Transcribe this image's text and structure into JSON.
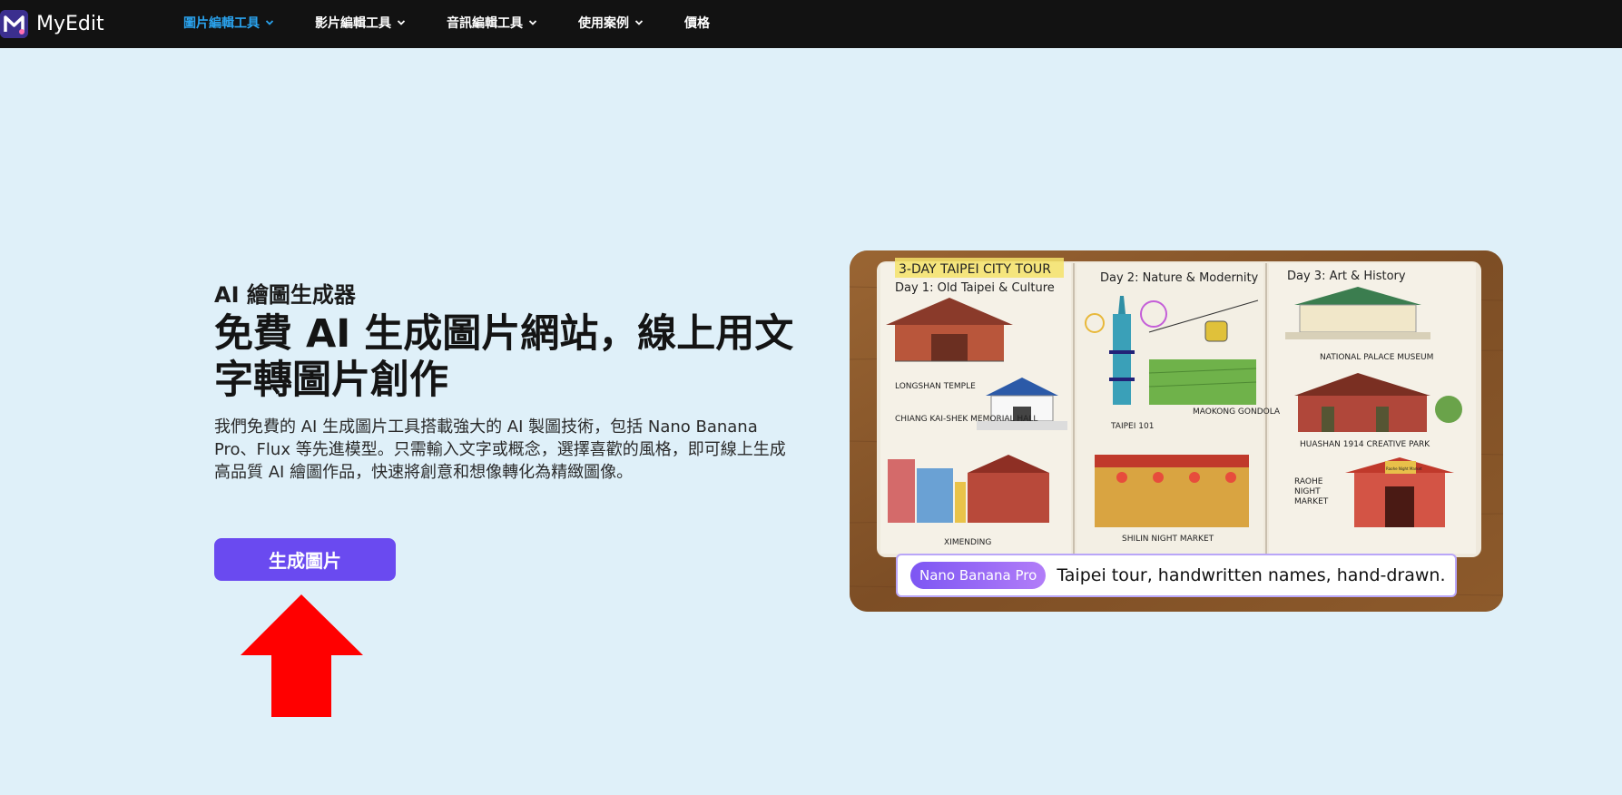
{
  "brand": {
    "name": "MyEdit"
  },
  "nav": [
    {
      "label": "圖片編輯工具",
      "active": true
    },
    {
      "label": "影片編輯工具"
    },
    {
      "label": "音訊編輯工具"
    },
    {
      "label": "使用案例"
    },
    {
      "label": "價格"
    }
  ],
  "hero": {
    "subtitle": "AI 繪圖生成器",
    "title": "免費 AI 生成圖片網站，線上用文字轉圖片創作",
    "description": "我們免費的 AI 生成圖片工具搭載強大的 AI 製圖技術，包括 Nano Banana Pro、Flux 等先進模型。只需輸入文字或概念，選擇喜歡的風格，即可線上生成高品質 AI 繪圖作品，快速將創意和想像轉化為精緻圖像。",
    "cta_label": "生成圖片"
  },
  "preview": {
    "journal_title": "3-DAY TAIPEI CITY TOUR",
    "day1": "Day 1: Old Taipei & Culture",
    "day2": "Day 2: Nature & Modernity",
    "day3": "Day 3: Art & History",
    "places": {
      "longshan": "LONGSHAN TEMPLE",
      "cks": "CHIANG KAI-SHEK MEMORIAL HALL",
      "ximending": "XIMENDING",
      "taipei101": "TAIPEI 101",
      "maokong": "MAOKONG GONDOLA",
      "shilin": "SHILIN NIGHT MARKET",
      "palace": "NATIONAL PALACE MUSEUM",
      "huashan": "HUASHAN 1914 CREATIVE PARK",
      "raohe": "RAOHE NIGHT MARKET",
      "raohe_sign": "Raohe Night Market"
    },
    "model_badge": "Nano Banana Pro",
    "prompt": "Taipei tour, handwritten names, hand-drawn."
  },
  "colors": {
    "nav_bg": "#121212",
    "nav_active": "#2aa3ee",
    "page_bg": "#dff0f9",
    "cta_bg": "#6a4af0",
    "arrow": "#ff0000"
  },
  "icons": {
    "logo": "myedit-logo-icon",
    "chevron": "chevron-down-icon",
    "arrow": "red-up-arrow-annotation"
  }
}
